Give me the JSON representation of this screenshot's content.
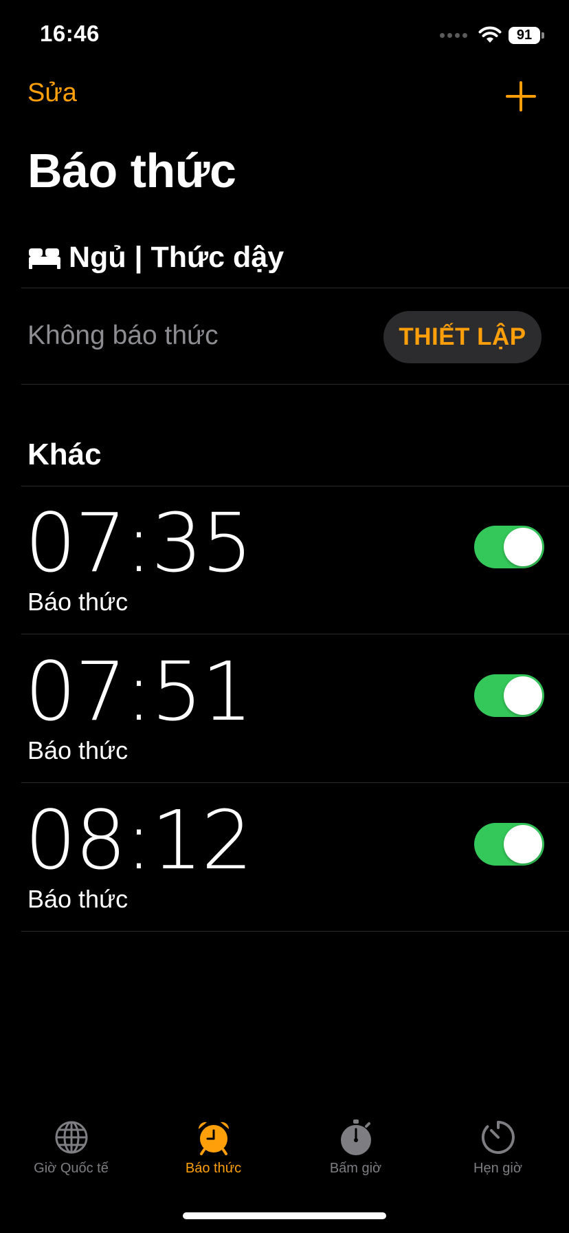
{
  "status_bar": {
    "time": "16:46",
    "battery": "91"
  },
  "nav": {
    "edit_label": "Sửa",
    "add_icon": "plus-icon"
  },
  "page_title": "Báo thức",
  "sleep": {
    "header_icon": "bed-icon",
    "header": "Ngủ | Thức dậy",
    "row_label": "Không báo thức",
    "setup_label": "THIẾT LẬP"
  },
  "other": {
    "header": "Khác",
    "alarms": [
      {
        "time": "07:35",
        "label": "Báo thức",
        "enabled": true
      },
      {
        "time": "07:51",
        "label": "Báo thức",
        "enabled": true
      },
      {
        "time": "08:12",
        "label": "Báo thức",
        "enabled": true
      }
    ]
  },
  "tabs": [
    {
      "label": "Giờ Quốc tế",
      "icon": "globe-icon",
      "active": false
    },
    {
      "label": "Báo thức",
      "icon": "alarm-clock-icon",
      "active": true
    },
    {
      "label": "Bấm giờ",
      "icon": "stopwatch-icon",
      "active": false
    },
    {
      "label": "Hẹn giờ",
      "icon": "timer-icon",
      "active": false
    }
  ],
  "colors": {
    "accent": "#ff9f0a",
    "toggle_on": "#34c759",
    "secondary_text": "#8d8d92",
    "background": "#000000"
  }
}
